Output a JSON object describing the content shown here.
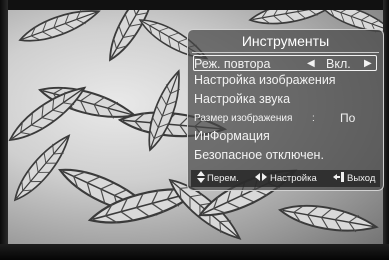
{
  "menu": {
    "title": "Инструменты",
    "items": [
      {
        "label": "Реж. повтора",
        "value": "Вкл.",
        "arrow_left": "◀",
        "arrow_right": "▶",
        "selected": true
      },
      {
        "label": "Настройка изображения"
      },
      {
        "label": "Настройка звука"
      },
      {
        "label": "Размер изображения",
        "colon": ":",
        "value": "По"
      },
      {
        "label": "ИнФормация"
      },
      {
        "label": "Безопасное отключен."
      }
    ],
    "footer": {
      "move_icon": "▲▼",
      "move_label": "Перем.",
      "adjust_icon": "◀▶",
      "adjust_label": "Настройка",
      "exit_icon": "exit-icon",
      "exit_label": "Выход"
    }
  },
  "colors": {
    "menu_bg": "#464646",
    "menu_border": "#e6e6e6",
    "text": "#f2f2f2"
  }
}
